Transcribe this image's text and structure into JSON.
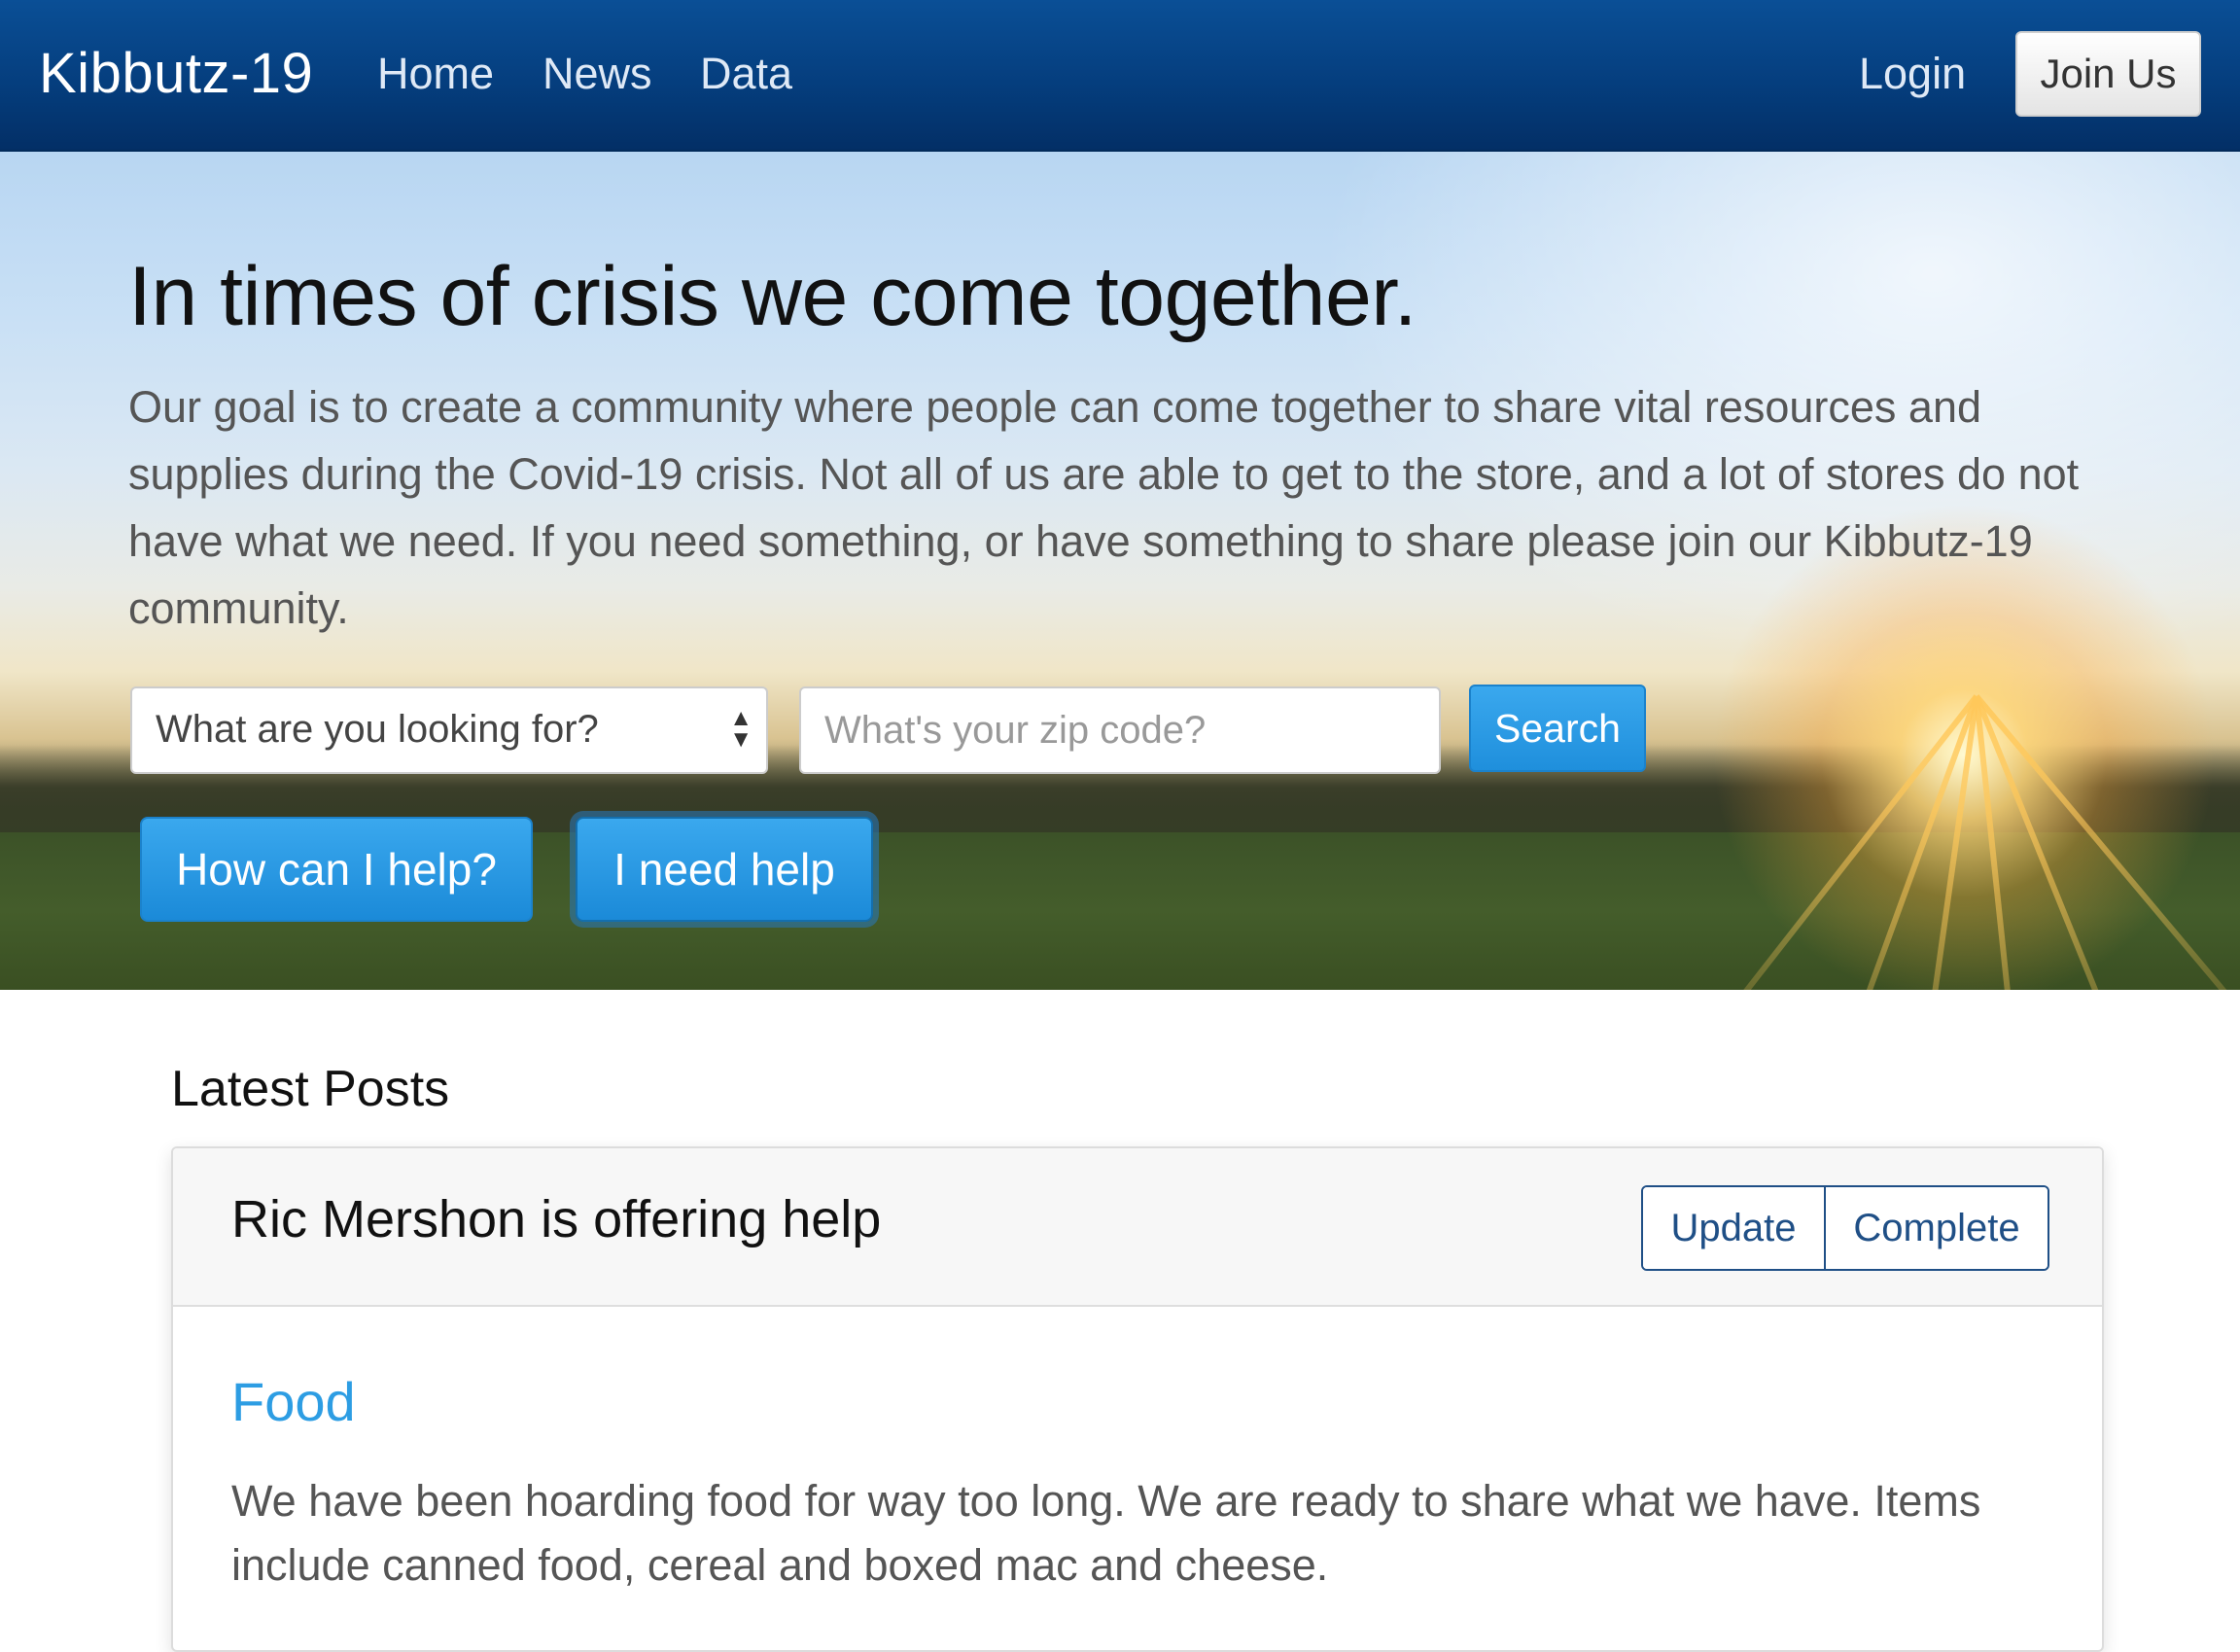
{
  "navbar": {
    "brand": "Kibbutz-19",
    "links": [
      "Home",
      "News",
      "Data"
    ],
    "login": "Login",
    "join": "Join Us"
  },
  "hero": {
    "title": "In times of crisis we come together.",
    "description": "Our goal is to create a community where people can come together to share vital resources and supplies during the Covid-19 crisis. Not all of us are able to get to the store, and a lot of stores do not have what we need. If you need something, or have something to share please join our Kibbutz-19 community.",
    "select_value": "What are you looking for?",
    "zip_placeholder": "What's your zip code?",
    "search_label": "Search",
    "help_label": "How can I help?",
    "need_help_label": "I need help"
  },
  "posts": {
    "heading": "Latest Posts",
    "items": [
      {
        "title": "Ric Mershon is offering help",
        "update_label": "Update",
        "complete_label": "Complete",
        "category": "Food",
        "body": "We have been hoarding food for way too long. We are ready to share what we have. Items include canned food, cereal and boxed mac and cheese."
      }
    ]
  },
  "colors": {
    "navbar": "#053e7e",
    "primary_button": "#2596e2",
    "link": "#2d9de3",
    "outline_button": "#1f4f86"
  }
}
